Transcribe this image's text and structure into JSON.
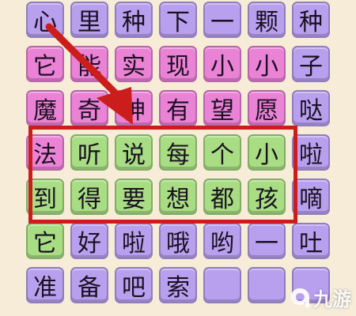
{
  "board": {
    "rows": [
      [
        {
          "char": "心",
          "color": "purple"
        },
        {
          "char": "里",
          "color": "purple"
        },
        {
          "char": "种",
          "color": "purple"
        },
        {
          "char": "下",
          "color": "purple"
        },
        {
          "char": "一",
          "color": "purple"
        },
        {
          "char": "颗",
          "color": "purple"
        },
        {
          "char": "种",
          "color": "purple"
        }
      ],
      [
        {
          "char": "它",
          "color": "pink"
        },
        {
          "char": "能",
          "color": "pink"
        },
        {
          "char": "实",
          "color": "pink"
        },
        {
          "char": "现",
          "color": "pink"
        },
        {
          "char": "小",
          "color": "pink"
        },
        {
          "char": "小",
          "color": "pink"
        },
        {
          "char": "子",
          "color": "purple"
        }
      ],
      [
        {
          "char": "魔",
          "color": "pink"
        },
        {
          "char": "奇",
          "color": "pink"
        },
        {
          "char": "神",
          "color": "pink"
        },
        {
          "char": "有",
          "color": "pink"
        },
        {
          "char": "望",
          "color": "pink"
        },
        {
          "char": "愿",
          "color": "pink"
        },
        {
          "char": "哒",
          "color": "purple"
        }
      ],
      [
        {
          "char": "法",
          "color": "pink"
        },
        {
          "char": "听",
          "color": "green"
        },
        {
          "char": "说",
          "color": "green"
        },
        {
          "char": "每",
          "color": "green"
        },
        {
          "char": "个",
          "color": "green"
        },
        {
          "char": "小",
          "color": "green"
        },
        {
          "char": "啦",
          "color": "purple"
        }
      ],
      [
        {
          "char": "到",
          "color": "green"
        },
        {
          "char": "得",
          "color": "green"
        },
        {
          "char": "要",
          "color": "green"
        },
        {
          "char": "想",
          "color": "green"
        },
        {
          "char": "都",
          "color": "green"
        },
        {
          "char": "孩",
          "color": "green"
        },
        {
          "char": "嘀",
          "color": "purple"
        }
      ],
      [
        {
          "char": "它",
          "color": "green"
        },
        {
          "char": "好",
          "color": "purple"
        },
        {
          "char": "啦",
          "color": "purple"
        },
        {
          "char": "哦",
          "color": "purple"
        },
        {
          "char": "哟",
          "color": "purple"
        },
        {
          "char": "一",
          "color": "purple"
        },
        {
          "char": "吐",
          "color": "purple"
        }
      ],
      [
        {
          "char": "准",
          "color": "purple"
        },
        {
          "char": "备",
          "color": "purple"
        },
        {
          "char": "吧",
          "color": "purple"
        },
        {
          "char": "索",
          "color": "purple"
        },
        {
          "char": "",
          "color": "purple"
        },
        {
          "char": "",
          "color": "purple"
        },
        {
          "char": "",
          "color": "purple"
        }
      ]
    ]
  },
  "colors": {
    "purple": "#b9a0ef",
    "pink": "#ea82d6",
    "green": "#a8dd84",
    "highlight": "#cc1d1d",
    "arrow": "#cc1d1d",
    "background": "#f6ecd8"
  },
  "watermark": {
    "logo_icon": "9game-logo-icon",
    "text": "九游"
  }
}
